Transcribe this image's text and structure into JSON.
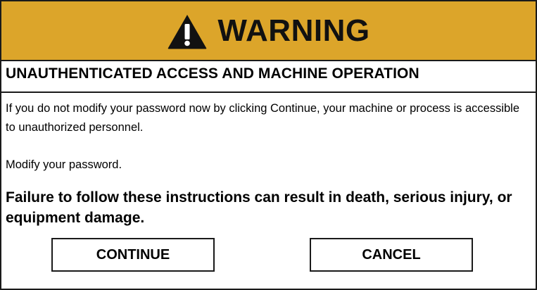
{
  "header": {
    "title": "WARNING",
    "icon": "warning-triangle-icon",
    "background_color": "#dca52a"
  },
  "subtitle": "UNAUTHENTICATED ACCESS AND MACHINE OPERATION",
  "body": {
    "paragraph1": "If you do not modify your password now by clicking Continue, your machine or process is accessible to unauthorized personnel.",
    "paragraph2": "Modify your password.",
    "consequence": "Failure to follow these instructions can result in death, serious injury, or equipment damage."
  },
  "buttons": {
    "continue_label": "CONTINUE",
    "cancel_label": "CANCEL"
  }
}
